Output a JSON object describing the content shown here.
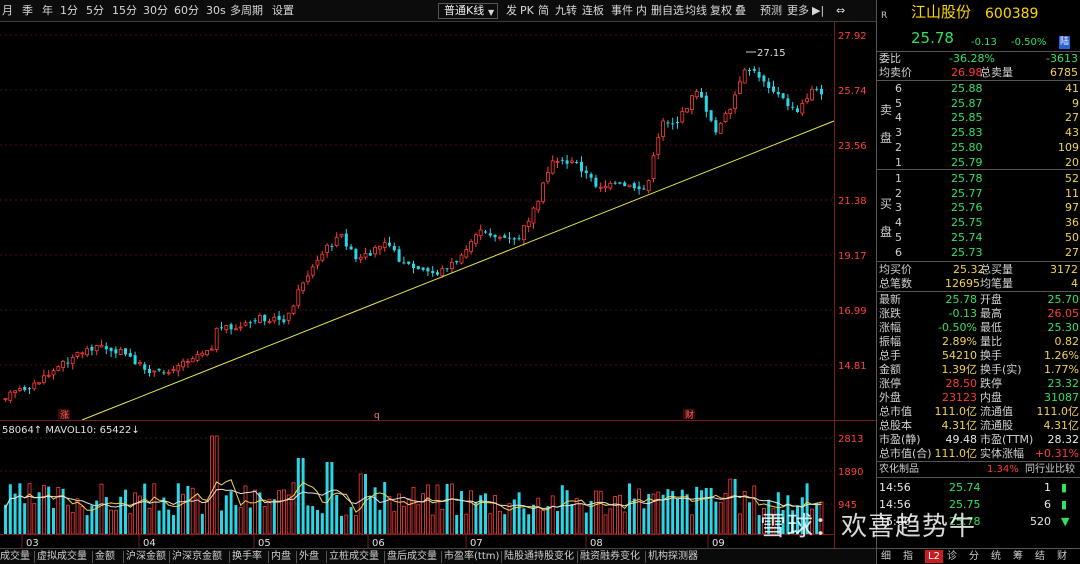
{
  "toolbar": {
    "periods": [
      "月",
      "季",
      "年",
      "1分",
      "5分",
      "15分",
      "30分",
      "60分",
      "30s",
      "多周期",
      "设置"
    ],
    "selected_period": "日",
    "chart_mode": "普通K线",
    "tools": [
      "发",
      "PK",
      "简",
      "九转",
      "连板",
      "事件"
    ],
    "tools2": [
      "内",
      "删自选",
      "均线",
      "复权",
      "叠",
      "预测",
      "更多"
    ]
  },
  "price_panel": {
    "y_ticks": [
      "27.92",
      "25.74",
      "23.56",
      "21.38",
      "19.17",
      "16.99",
      "14.81"
    ],
    "high_marker": "27.15",
    "event_markers": [
      "涨",
      "q",
      "财"
    ]
  },
  "volume_panel": {
    "indicator_label": "58064↑  MAVOL10: 65422↓",
    "y_ticks": [
      "2813",
      "1890",
      "945"
    ],
    "x_ticks": [
      "03",
      "04",
      "05",
      "06",
      "07",
      "08",
      "09"
    ]
  },
  "bottom_tabs": [
    "成交量",
    "虚拟成交量",
    "金额",
    "沪深金额",
    "沪深京金额",
    "换手率",
    "内盘",
    "外盘",
    "立桩成交量",
    "盘后成交量",
    "市盈率(ttm)",
    "陆股通持股变化",
    "融资融券变化",
    "机构探测器"
  ],
  "quote": {
    "badge": "R",
    "stock_name": "江山股份",
    "stock_code": "600389",
    "price": "25.78",
    "change": "-0.13",
    "change_pct": "-0.50%",
    "tag": "陆",
    "weibi_label": "委比",
    "weibi_pct": "-36.28%",
    "weibi_diff": "-3613",
    "avg_sell_label": "均卖价",
    "avg_sell": "26.98",
    "total_sell_label": "总卖量",
    "total_sell": "6785",
    "sell_side_label": [
      "卖",
      "盘"
    ],
    "buy_side_label": [
      "买",
      "盘"
    ],
    "sell_book": [
      {
        "level": "6",
        "price": "25.88",
        "vol": "41"
      },
      {
        "level": "5",
        "price": "25.87",
        "vol": "9"
      },
      {
        "level": "4",
        "price": "25.85",
        "vol": "27"
      },
      {
        "level": "3",
        "price": "25.83",
        "vol": "43"
      },
      {
        "level": "2",
        "price": "25.80",
        "vol": "109"
      },
      {
        "level": "1",
        "price": "25.79",
        "vol": "20"
      }
    ],
    "buy_book": [
      {
        "level": "1",
        "price": "25.78",
        "vol": "52"
      },
      {
        "level": "2",
        "price": "25.77",
        "vol": "11"
      },
      {
        "level": "3",
        "price": "25.76",
        "vol": "97"
      },
      {
        "level": "4",
        "price": "25.75",
        "vol": "36"
      },
      {
        "level": "5",
        "price": "25.74",
        "vol": "50"
      },
      {
        "level": "6",
        "price": "25.73",
        "vol": "27"
      }
    ],
    "avg_buy_label": "均买价",
    "avg_buy": "25.32",
    "total_buy_label": "总买量",
    "total_buy": "3172",
    "total_trades_label": "总笔数",
    "total_trades": "12695",
    "avg_trade_label": "均笔量",
    "avg_trade": "4",
    "stats": [
      {
        "l1": "最新",
        "v1": "25.78",
        "c1": "green",
        "l2": "开盘",
        "v2": "25.70",
        "c2": "green"
      },
      {
        "l1": "涨跌",
        "v1": "-0.13",
        "c1": "green",
        "l2": "最高",
        "v2": "26.05",
        "c2": "red"
      },
      {
        "l1": "涨幅",
        "v1": "-0.50%",
        "c1": "green",
        "l2": "最低",
        "v2": "25.30",
        "c2": "green"
      },
      {
        "l1": "振幅",
        "v1": "2.89%",
        "c1": "yellow",
        "l2": "量比",
        "v2": "0.82",
        "c2": "yellow"
      },
      {
        "l1": "总手",
        "v1": "54210",
        "c1": "yellow",
        "l2": "换手",
        "v2": "1.26%",
        "c2": "yellow"
      },
      {
        "l1": "金额",
        "v1": "1.39亿",
        "c1": "yellow",
        "l2": "换手(实)",
        "v2": "1.77%",
        "c2": "yellow"
      },
      {
        "l1": "涨停",
        "v1": "28.50",
        "c1": "red",
        "l2": "跌停",
        "v2": "23.32",
        "c2": "green"
      },
      {
        "l1": "外盘",
        "v1": "23123",
        "c1": "red",
        "l2": "内盘",
        "v2": "31087",
        "c2": "green"
      },
      {
        "l1": "总市值",
        "v1": "111.0亿",
        "c1": "yellow",
        "l2": "流通值",
        "v2": "111.0亿",
        "c2": "yellow"
      },
      {
        "l1": "总股本",
        "v1": "4.31亿",
        "c1": "yellow",
        "l2": "流通股",
        "v2": "4.31亿",
        "c2": "yellow"
      },
      {
        "l1": "市盈(静)",
        "v1": "49.48",
        "c1": "white",
        "l2": "市盈(TTM)",
        "v2": "28.32",
        "c2": "white"
      },
      {
        "l1": "总市值(合)",
        "v1": "111.0亿",
        "c1": "yellow",
        "l2": "实体涨幅",
        "v2": "+0.31%",
        "c2": "red"
      }
    ],
    "sector_name": "农化制品",
    "sector_pct": "1.34%",
    "sector_compare": "同行业比较",
    "ticks": [
      {
        "time": "14:56",
        "price": "25.74",
        "vol": "1"
      },
      {
        "time": "14:56",
        "price": "25.75",
        "vol": "6"
      },
      {
        "time": "15:00",
        "price": "25.78",
        "vol": "520"
      }
    ],
    "side_tabs": [
      "细",
      "指",
      "L2",
      "诊",
      "分",
      "统",
      "筹",
      "结",
      "财"
    ],
    "active_side_tab": "L2"
  },
  "watermark": "雪球：欢喜趋势牛",
  "colors": {
    "up": "#ff3b3b",
    "down": "#29d6e6",
    "trend": "#e8e84a",
    "ma": "#f2d24b"
  }
}
